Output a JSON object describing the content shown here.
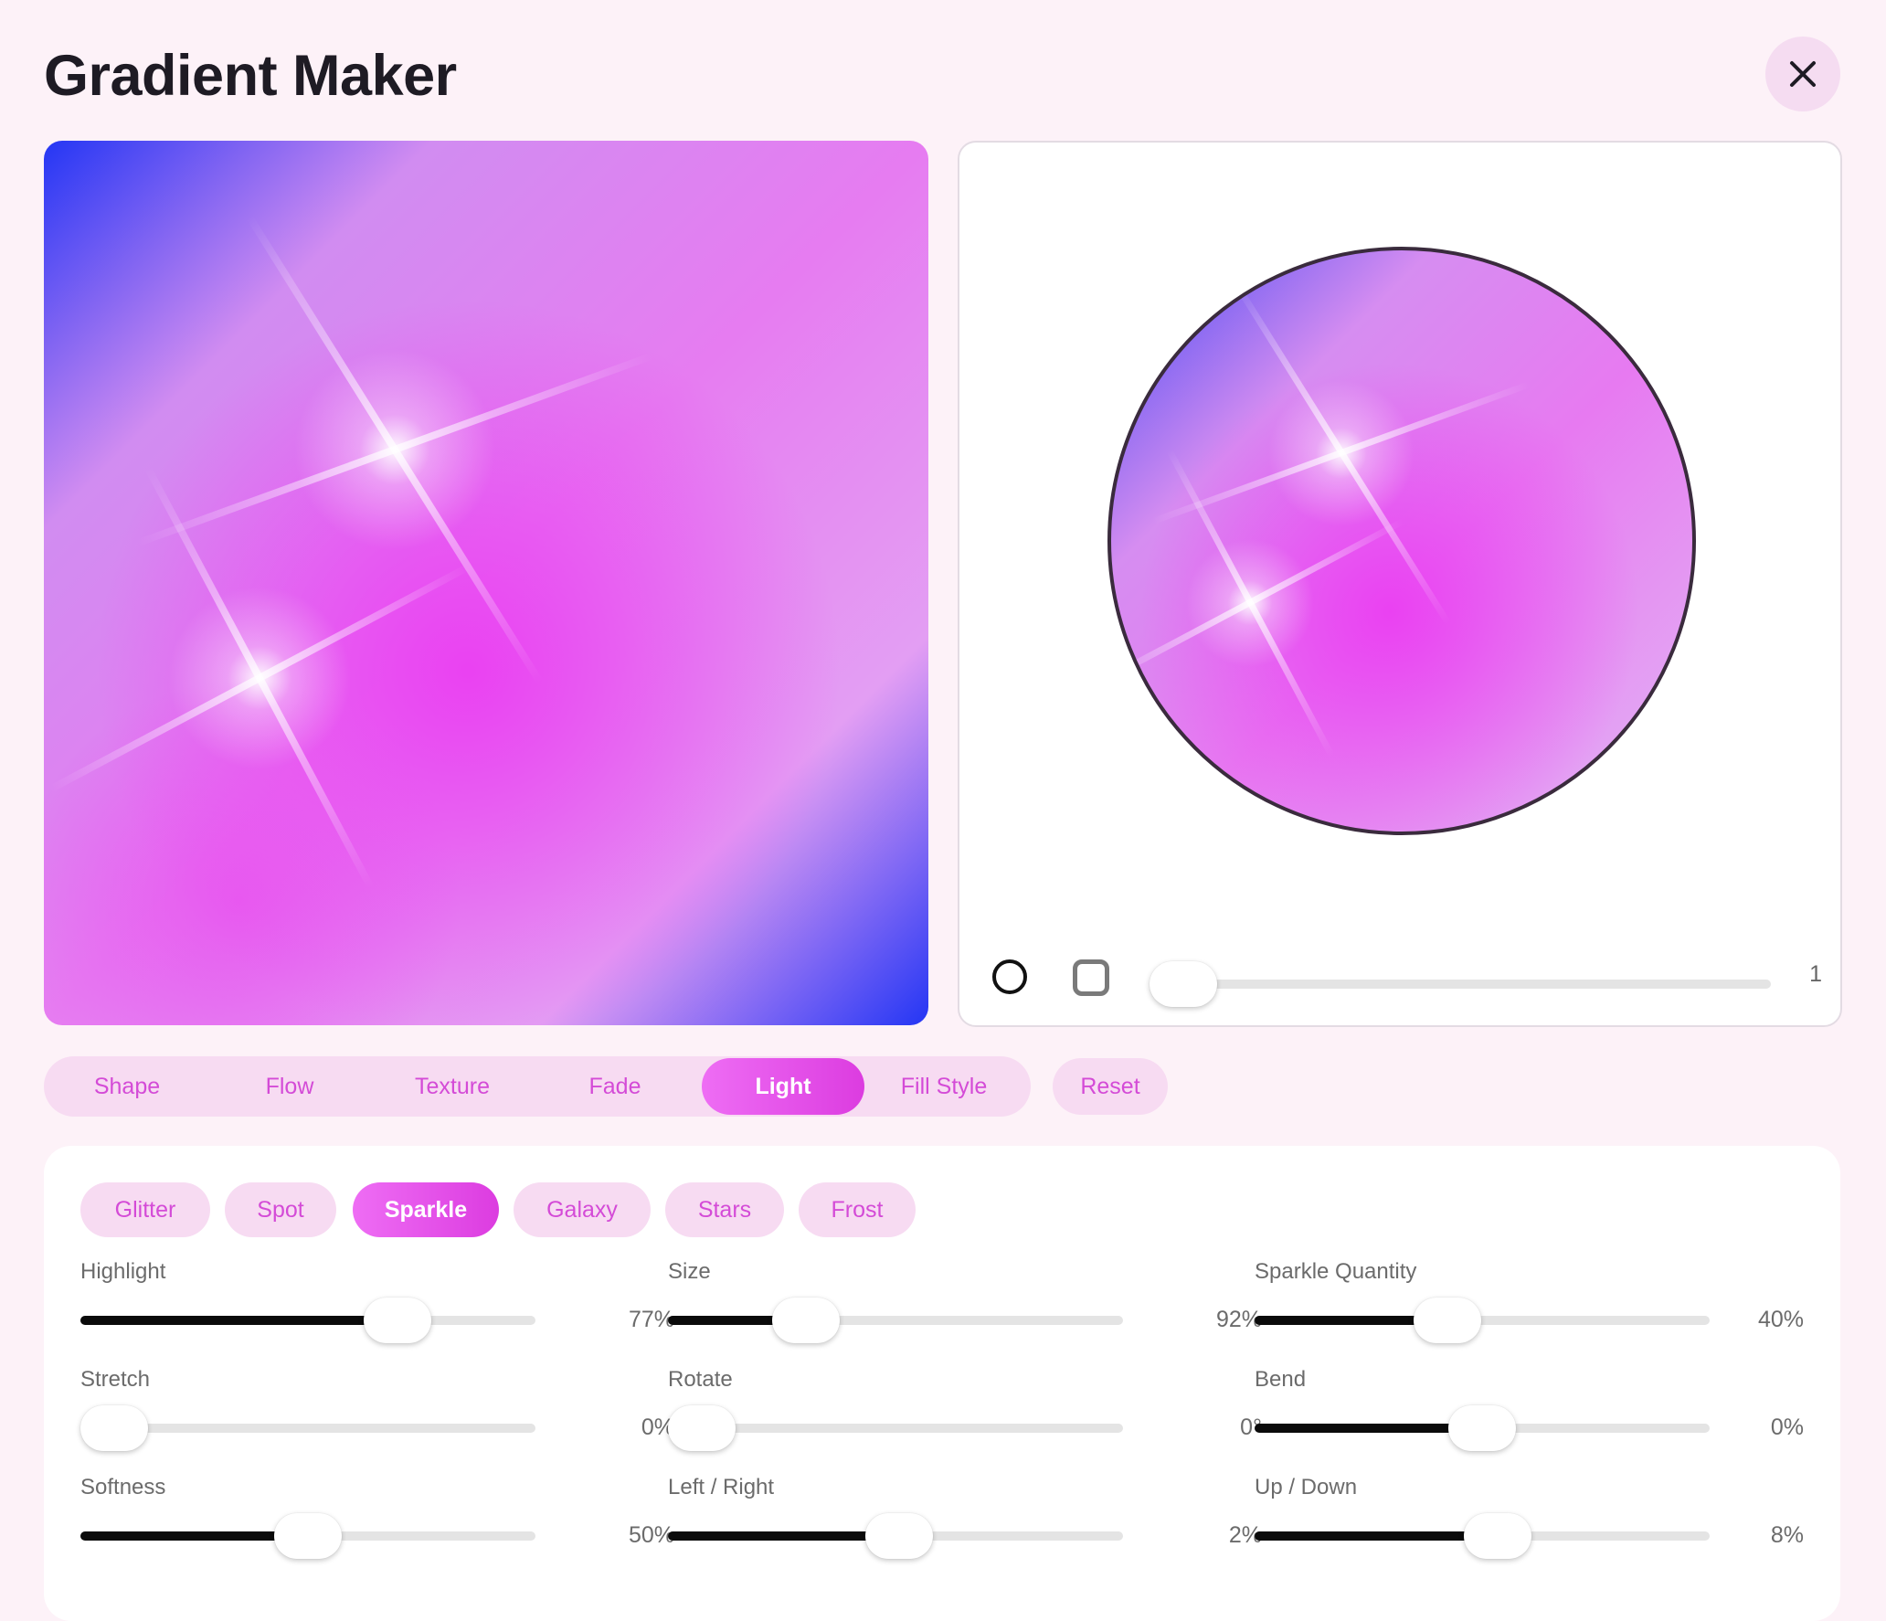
{
  "app": {
    "title": "Gradient Maker"
  },
  "icons": {
    "close": "close-icon",
    "shape_circle": "circle-shape-icon",
    "shape_square": "rounded-square-shape-icon"
  },
  "colors": {
    "accent": "#e040e8",
    "gradient_stops": [
      "#2537f5",
      "#e07ef0",
      "#e84af0",
      "#e8a0f2"
    ],
    "tab_text": "#d44bd7"
  },
  "side_preview": {
    "shape": "circle",
    "slider_value": "1",
    "slider_fraction": 0.0
  },
  "tabs": [
    {
      "label": "Shape"
    },
    {
      "label": "Flow"
    },
    {
      "label": "Texture"
    },
    {
      "label": "Fade"
    },
    {
      "label": "Light",
      "active": true
    },
    {
      "label": "Fill Style"
    }
  ],
  "reset_label": "Reset",
  "effects": [
    {
      "label": "Glitter"
    },
    {
      "label": "Spot"
    },
    {
      "label": "Sparkle",
      "active": true
    },
    {
      "label": "Galaxy"
    },
    {
      "label": "Stars"
    },
    {
      "label": "Frost"
    }
  ],
  "controls": [
    {
      "label": "Highlight",
      "value": "77%",
      "fraction": 0.73
    },
    {
      "label": "Size",
      "value": "92%",
      "fraction": 0.27
    },
    {
      "label": "Sparkle Quantity",
      "value": "40%",
      "fraction": 0.41
    },
    {
      "label": "Stretch",
      "value": "0%",
      "fraction": 0.0
    },
    {
      "label": "Rotate",
      "value": "0°",
      "fraction": 0.0
    },
    {
      "label": "Bend",
      "value": "0%",
      "fraction": 0.5
    },
    {
      "label": "Softness",
      "value": "50%",
      "fraction": 0.5
    },
    {
      "label": "Left / Right",
      "value": "2%",
      "fraction": 0.51
    },
    {
      "label": "Up / Down",
      "value": "8%",
      "fraction": 0.54
    }
  ]
}
